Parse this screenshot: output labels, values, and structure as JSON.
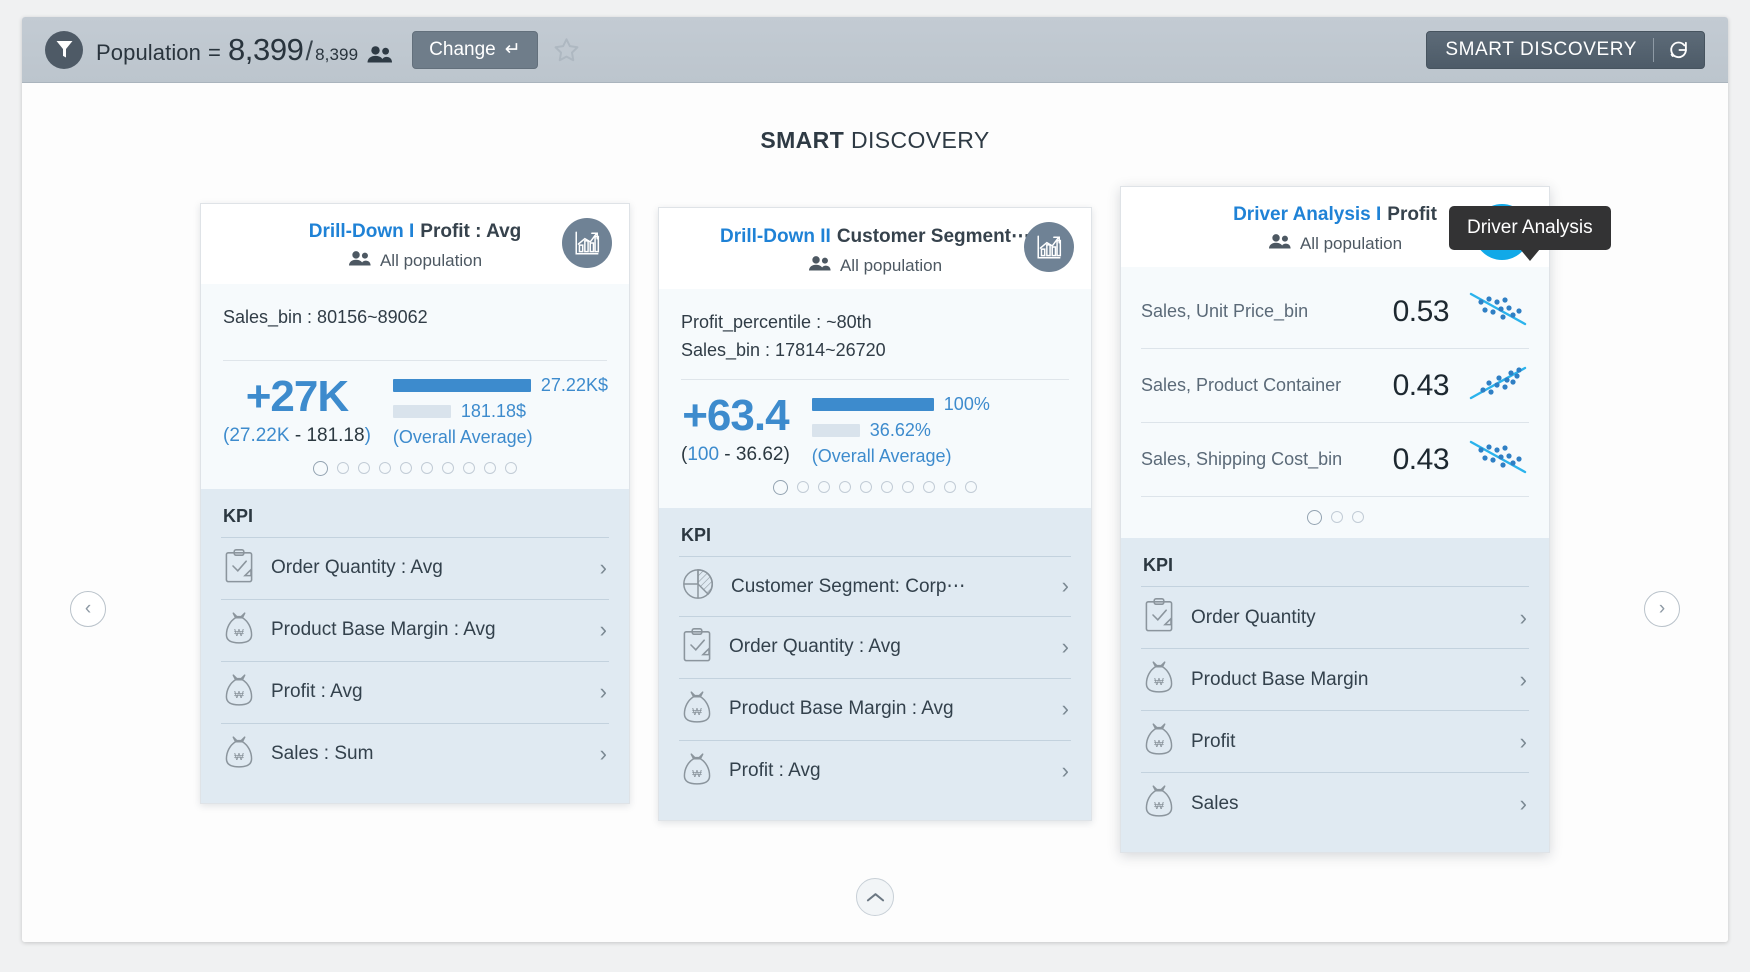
{
  "header": {
    "filter_icon": "funnel-icon",
    "population_label": "Population",
    "equals": "=",
    "population_current": "8,399",
    "slash": "/",
    "population_total": "8,399",
    "people_icon": "people-icon",
    "change_label": "Change",
    "change_enter_glyph": "↵",
    "favorite_icon": "star-icon",
    "smart_discovery_label": "SMART DISCOVERY",
    "refresh_icon": "refresh-icon"
  },
  "page": {
    "title_bold": "SMART",
    "title_rest": " DISCOVERY",
    "prev_arrow": "‹",
    "next_arrow": "›",
    "collapse_icon": "chevron-up-icon"
  },
  "tooltip": {
    "text": "Driver Analysis"
  },
  "cards": [
    {
      "id": "drill-down-1",
      "title_prefix": "Drill-Down I",
      "title_metric": "Profit : Avg",
      "population_icon": "people-icon",
      "population_text": "All population",
      "badge_icon": "bar-chart-trend-icon",
      "conditions": [
        "Sales_bin : 80156~89062"
      ],
      "big_value": "+27K",
      "big_range_open": "(",
      "big_range_high": "27.22K",
      "big_range_dash": " - ",
      "big_range_low": "181.18",
      "big_range_close": ")",
      "bar_high_label": "27.22K$",
      "bar_low_label": "181.18$",
      "bar_note": "(Overall Average)",
      "bar_high_pct": 76,
      "bar_low_pct": 22,
      "dots_total": 10,
      "dots_active": 1,
      "kpi_title": "KPI",
      "kpi_items": [
        {
          "icon": "clipboard-check-icon",
          "label": "Order Quantity : Avg",
          "chevron": "›"
        },
        {
          "icon": "money-bag-icon",
          "label": "Product Base Margin : Avg",
          "chevron": "›"
        },
        {
          "icon": "money-bag-icon",
          "label": "Profit : Avg",
          "chevron": "›"
        },
        {
          "icon": "money-bag-icon",
          "label": "Sales : Sum",
          "chevron": "›"
        }
      ]
    },
    {
      "id": "drill-down-2",
      "title_prefix": "Drill-Down II",
      "title_metric": "Customer Segment⋯",
      "population_icon": "people-icon",
      "population_text": "All population",
      "badge_icon": "bar-chart-trend-icon",
      "conditions": [
        "Profit_percentile : ~80th",
        "Sales_bin : 17814~26720"
      ],
      "big_value": "+63.4",
      "big_range_open": "(",
      "big_range_high": "100",
      "big_range_dash": " - ",
      "big_range_low": "36.62",
      "big_range_close": ")",
      "bar_high_label": "100%",
      "bar_low_label": "36.62%",
      "bar_note": "(Overall Average)",
      "bar_high_pct": 72,
      "bar_low_pct": 26,
      "dots_total": 10,
      "dots_active": 1,
      "kpi_title": "KPI",
      "kpi_items": [
        {
          "icon": "pie-chart-icon",
          "label": "Customer Segment: Corp⋯",
          "chevron": "›"
        },
        {
          "icon": "clipboard-check-icon",
          "label": "Order Quantity : Avg",
          "chevron": "›"
        },
        {
          "icon": "money-bag-icon",
          "label": "Product Base Margin : Avg",
          "chevron": "›"
        },
        {
          "icon": "money-bag-icon",
          "label": "Profit : Avg",
          "chevron": "›"
        }
      ]
    }
  ],
  "driver_card": {
    "id": "driver-analysis-1",
    "title_prefix": "Driver Analysis I",
    "title_metric": "Profit",
    "population_icon": "people-icon",
    "population_text": "All population",
    "badge_icon": "share-icon",
    "rows": [
      {
        "name": "Sales, Unit Price_bin",
        "value": "0.53",
        "icon": "scatter-negative-icon",
        "trend": "negative"
      },
      {
        "name": "Sales, Product Container",
        "value": "0.43",
        "icon": "scatter-positive-icon",
        "trend": "positive"
      },
      {
        "name": "Sales, Shipping Cost_bin",
        "value": "0.43",
        "icon": "scatter-negative-icon",
        "trend": "negative"
      }
    ],
    "dots_total": 3,
    "dots_active": 1,
    "kpi_title": "KPI",
    "kpi_items": [
      {
        "icon": "clipboard-check-icon",
        "label": "Order Quantity",
        "chevron": "›"
      },
      {
        "icon": "money-bag-icon",
        "label": "Product Base Margin",
        "chevron": "›"
      },
      {
        "icon": "money-bag-icon",
        "label": "Profit",
        "chevron": "›"
      },
      {
        "icon": "money-bag-icon",
        "label": "Sales",
        "chevron": "›"
      }
    ]
  },
  "colors": {
    "accent_blue": "#3d8bcd",
    "link_blue": "#1f82d6",
    "share_blue": "#11a9e8",
    "badge_gray": "#6f8295",
    "kpi_bg": "#e0eaf2",
    "tooltip_bg": "#333334"
  }
}
